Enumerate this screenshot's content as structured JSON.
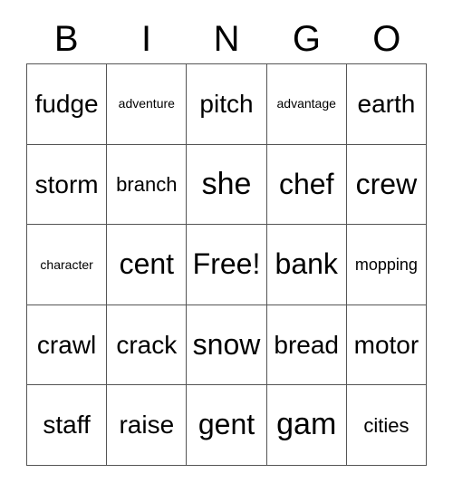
{
  "card": {
    "title": "BINGO",
    "header_letters": [
      "B",
      "I",
      "N",
      "G",
      "O"
    ],
    "free_space_label": "Free!",
    "colors": {
      "text": "#000000",
      "grid_line": "#555555",
      "background": "#ffffff"
    },
    "rows": [
      [
        {
          "word": "fudge"
        },
        {
          "word": "adventure"
        },
        {
          "word": "pitch"
        },
        {
          "word": "advantage"
        },
        {
          "word": "earth"
        }
      ],
      [
        {
          "word": "storm"
        },
        {
          "word": "branch"
        },
        {
          "word": "she"
        },
        {
          "word": "chef"
        },
        {
          "word": "crew"
        }
      ],
      [
        {
          "word": "character"
        },
        {
          "word": "cent"
        },
        {
          "word": "Free!"
        },
        {
          "word": "bank"
        },
        {
          "word": "mopping"
        }
      ],
      [
        {
          "word": "crawl"
        },
        {
          "word": "crack"
        },
        {
          "word": "snow"
        },
        {
          "word": "bread"
        },
        {
          "word": "motor"
        }
      ],
      [
        {
          "word": "staff"
        },
        {
          "word": "raise"
        },
        {
          "word": "gent"
        },
        {
          "word": "gam"
        },
        {
          "word": "cities"
        }
      ]
    ]
  }
}
